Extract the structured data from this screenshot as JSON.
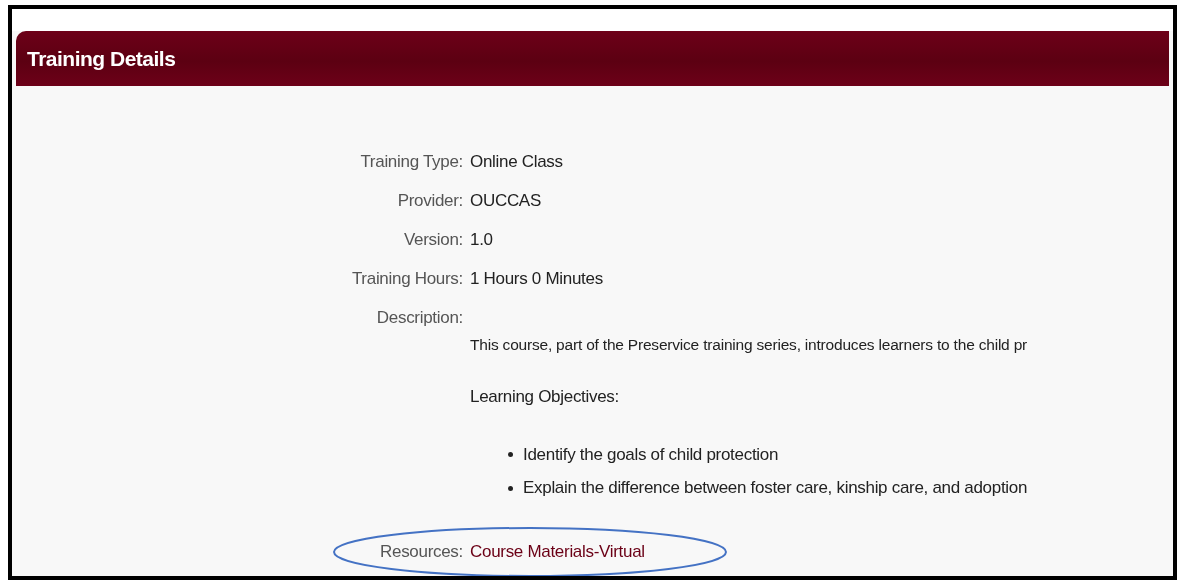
{
  "panel": {
    "title": "Training Details"
  },
  "fields": [
    {
      "label": "Training Type:",
      "value": "Online Class",
      "kind": "text"
    },
    {
      "label": "Provider:",
      "value": "OUCCAS",
      "kind": "text"
    },
    {
      "label": "Version:",
      "value": "1.0",
      "kind": "text"
    },
    {
      "label": "Training Hours:",
      "value": "1 Hours 0 Minutes",
      "kind": "text"
    },
    {
      "label": "Description:",
      "kind": "description",
      "paragraph": "This course, part of the Preservice training series, introduces learners to the child pr",
      "objectives_heading": "Learning Objectives:",
      "objectives": [
        "Identify the goals of child protection",
        "Explain the difference between foster care, kinship care, and adoption"
      ]
    },
    {
      "label": "Resources:",
      "value": "Course Materials-Virtual",
      "kind": "link",
      "circled": true
    }
  ]
}
